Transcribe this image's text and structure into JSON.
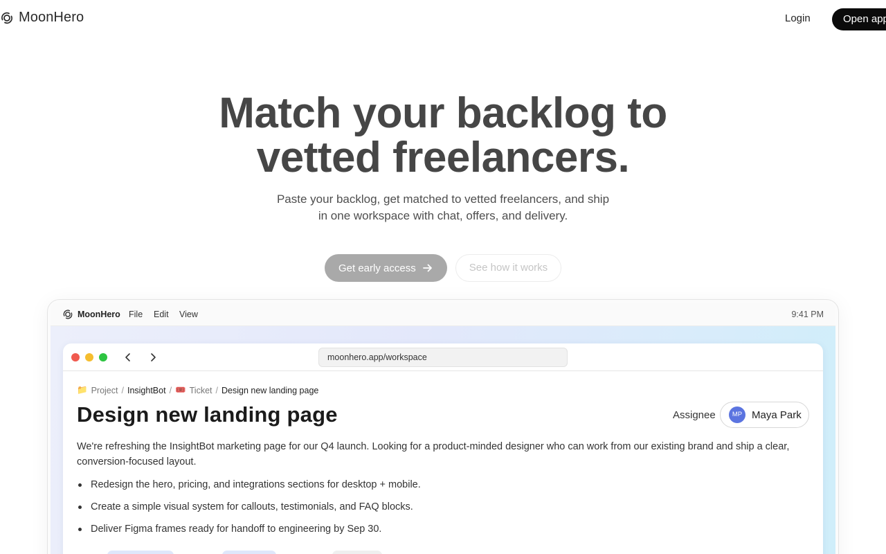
{
  "brand": {
    "name": "MoonHero",
    "logo_icon": "moon-orbit-icon"
  },
  "nav": {
    "login": "Login",
    "open_app": "Open app"
  },
  "hero": {
    "title_line1": "Match your backlog to",
    "title_line2": "vetted freelancers.",
    "subtitle_line1": "Paste your backlog, get matched to vetted freelancers, and ship",
    "subtitle_line2": "in one workspace with chat, offers, and delivery.",
    "primary_cta": "Get early access",
    "secondary_cta": "See how it works"
  },
  "app_menubar": {
    "brand": "MoonHero",
    "menus": [
      "File",
      "Edit",
      "View"
    ],
    "time": "9:41 PM"
  },
  "browser": {
    "url": "moonhero.app/workspace"
  },
  "ticket": {
    "breadcrumb": {
      "project_icon": "📁",
      "project_label": "Project",
      "project_name": "InsightBot",
      "ticket_icon": "🎟️",
      "ticket_label": "Ticket",
      "ticket_name": "Design new landing page",
      "separator": "/"
    },
    "title": "Design new landing page",
    "assignee_label": "Assignee",
    "assignee_initials": "MP",
    "assignee_name": "Maya Park",
    "description": "We're refreshing the InsightBot marketing page for our Q4 launch. Looking for a product-minded designer who can work from our existing brand and ship a clear, conversion-focused layout.",
    "bullets": [
      "Redesign the hero, pricing, and integrations sections for desktop + mobile.",
      "Create a simple visual system for callouts, testimonials, and FAQ blocks.",
      "Deliver Figma frames ready for handoff to engineering by Sep 30."
    ]
  },
  "colors": {
    "primary_button": "#a9a9a9",
    "open_app_bg": "#0b0b0b",
    "avatar": "#5b74e0",
    "traffic_red": "#f05a4f",
    "traffic_yellow": "#f5bd2f",
    "traffic_green": "#2dc441"
  }
}
